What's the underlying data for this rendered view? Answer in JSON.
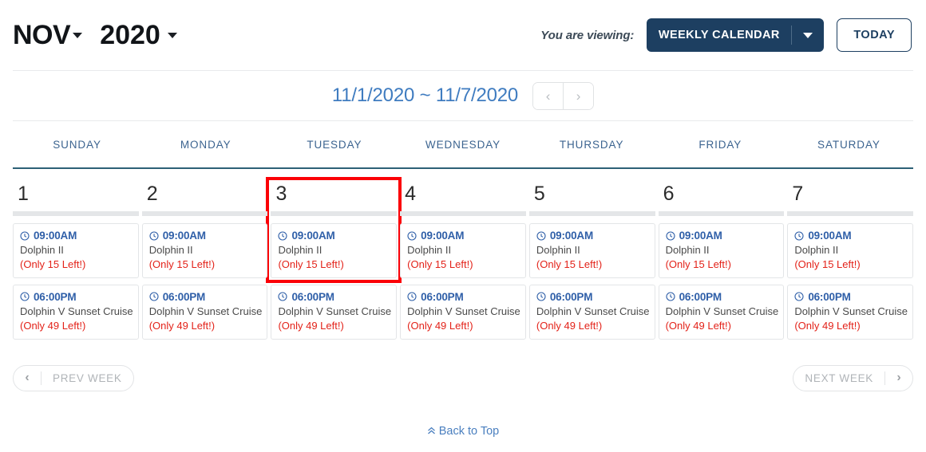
{
  "header": {
    "month": "NOV",
    "year": "2020",
    "month_caret_icon": "caret-down-icon",
    "year_caret_icon": "caret-down-icon",
    "viewing_label": "You are viewing:",
    "view_selected": "WEEKLY CALENDAR",
    "view_caret_icon": "caret-down-icon",
    "today_label": "TODAY"
  },
  "range": {
    "text": "11/1/2020 ~ 11/7/2020",
    "prev_icon": "chevron-left-icon",
    "next_icon": "chevron-right-icon",
    "prev_glyph": "‹",
    "next_glyph": "›"
  },
  "weekdays": [
    "SUNDAY",
    "MONDAY",
    "TUESDAY",
    "WEDNESDAY",
    "THURSDAY",
    "FRIDAY",
    "SATURDAY"
  ],
  "days": [
    {
      "number": "1",
      "events": [
        {
          "time": "09:00AM",
          "title": "Dolphin II",
          "availability": "(Only 15 Left!)",
          "icon": "clock-icon"
        },
        {
          "time": "06:00PM",
          "title": "Dolphin V Sunset Cruise",
          "availability": "(Only 49 Left!)",
          "icon": "clock-icon"
        }
      ]
    },
    {
      "number": "2",
      "events": [
        {
          "time": "09:00AM",
          "title": "Dolphin II",
          "availability": "(Only 15 Left!)",
          "icon": "clock-icon"
        },
        {
          "time": "06:00PM",
          "title": "Dolphin V Sunset Cruise",
          "availability": "(Only 49 Left!)",
          "icon": "clock-icon"
        }
      ]
    },
    {
      "number": "3",
      "highlighted": true,
      "events": [
        {
          "time": "09:00AM",
          "title": "Dolphin II",
          "availability": "(Only 15 Left!)",
          "icon": "clock-icon"
        },
        {
          "time": "06:00PM",
          "title": "Dolphin V Sunset Cruise",
          "availability": "(Only 49 Left!)",
          "icon": "clock-icon"
        }
      ]
    },
    {
      "number": "4",
      "events": [
        {
          "time": "09:00AM",
          "title": "Dolphin II",
          "availability": "(Only 15 Left!)",
          "icon": "clock-icon"
        },
        {
          "time": "06:00PM",
          "title": "Dolphin V Sunset Cruise",
          "availability": "(Only 49 Left!)",
          "icon": "clock-icon"
        }
      ]
    },
    {
      "number": "5",
      "events": [
        {
          "time": "09:00AM",
          "title": "Dolphin II",
          "availability": "(Only 15 Left!)",
          "icon": "clock-icon"
        },
        {
          "time": "06:00PM",
          "title": "Dolphin V Sunset Cruise",
          "availability": "(Only 49 Left!)",
          "icon": "clock-icon"
        }
      ]
    },
    {
      "number": "6",
      "events": [
        {
          "time": "09:00AM",
          "title": "Dolphin II",
          "availability": "(Only 15 Left!)",
          "icon": "clock-icon"
        },
        {
          "time": "06:00PM",
          "title": "Dolphin V Sunset Cruise",
          "availability": "(Only 49 Left!)",
          "icon": "clock-icon"
        }
      ]
    },
    {
      "number": "7",
      "events": [
        {
          "time": "09:00AM",
          "title": "Dolphin II",
          "availability": "(Only 15 Left!)",
          "icon": "clock-icon"
        },
        {
          "time": "06:00PM",
          "title": "Dolphin V Sunset Cruise",
          "availability": "(Only 49 Left!)",
          "icon": "clock-icon"
        }
      ]
    }
  ],
  "week_nav": {
    "prev_label": "PREV WEEK",
    "next_label": "NEXT WEEK",
    "prev_icon": "chevron-left-icon",
    "next_icon": "chevron-right-icon",
    "prev_glyph": "‹",
    "next_glyph": "›"
  },
  "footer": {
    "back_to_top": "Back to Top",
    "back_to_top_icon": "double-chevron-up-icon",
    "back_to_top_glyph": "«"
  },
  "colors": {
    "navy": "#1d3f61",
    "link_blue": "#3f7cc0",
    "time_blue": "#2f5fa8",
    "weekday_blue": "#3c6490",
    "alert_red": "#e32219",
    "highlight_red": "#fb0007",
    "header_underline": "#2d6076"
  }
}
